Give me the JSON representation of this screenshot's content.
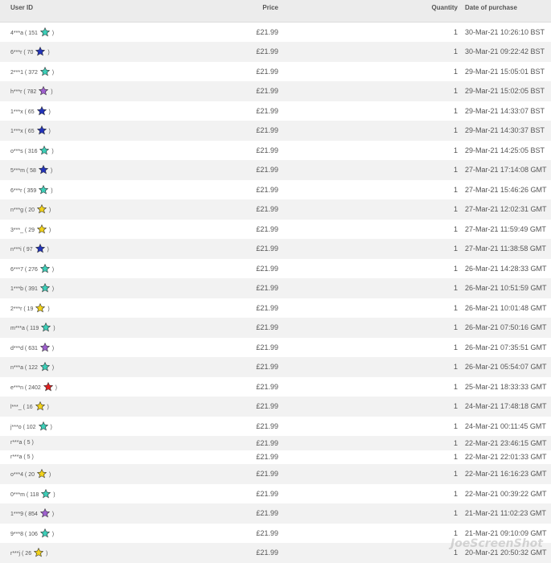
{
  "columns": {
    "user": "User ID",
    "price": "Price",
    "quantity": "Quantity",
    "date": "Date of purchase"
  },
  "star_colors": {
    "teal": "#3ccfb8",
    "blue": "#2233bb",
    "purple": "#a060d0",
    "yellow": "#f2d21a",
    "red": "#e02020"
  },
  "rows": [
    {
      "user": "4***a",
      "rating": "151",
      "star": "teal",
      "price": "£21.99",
      "qty": "1",
      "date": "30-Mar-21 10:26:10 BST"
    },
    {
      "user": "6***r",
      "rating": "70",
      "star": "blue",
      "price": "£21.99",
      "qty": "1",
      "date": "30-Mar-21 09:22:42 BST"
    },
    {
      "user": "2***1",
      "rating": "372",
      "star": "teal",
      "price": "£21.99",
      "qty": "1",
      "date": "29-Mar-21 15:05:01 BST"
    },
    {
      "user": "h***r",
      "rating": "782",
      "star": "purple",
      "price": "£21.99",
      "qty": "1",
      "date": "29-Mar-21 15:02:05 BST"
    },
    {
      "user": "1***x",
      "rating": "65",
      "star": "blue",
      "price": "£21.99",
      "qty": "1",
      "date": "29-Mar-21 14:33:07 BST"
    },
    {
      "user": "1***x",
      "rating": "65",
      "star": "blue",
      "price": "£21.99",
      "qty": "1",
      "date": "29-Mar-21 14:30:37 BST"
    },
    {
      "user": "o***s",
      "rating": "316",
      "star": "teal",
      "price": "£21.99",
      "qty": "1",
      "date": "29-Mar-21 14:25:05 BST"
    },
    {
      "user": "5***m",
      "rating": "58",
      "star": "blue",
      "price": "£21.99",
      "qty": "1",
      "date": "27-Mar-21 17:14:08 GMT"
    },
    {
      "user": "6***r",
      "rating": "359",
      "star": "teal",
      "price": "£21.99",
      "qty": "1",
      "date": "27-Mar-21 15:46:26 GMT"
    },
    {
      "user": "n***g",
      "rating": "20",
      "star": "yellow",
      "price": "£21.99",
      "qty": "1",
      "date": "27-Mar-21 12:02:31 GMT"
    },
    {
      "user": "3***_",
      "rating": "29",
      "star": "yellow",
      "price": "£21.99",
      "qty": "1",
      "date": "27-Mar-21 11:59:49 GMT"
    },
    {
      "user": "n***i",
      "rating": "97",
      "star": "blue",
      "price": "£21.99",
      "qty": "1",
      "date": "27-Mar-21 11:38:58 GMT"
    },
    {
      "user": "6***7",
      "rating": "276",
      "star": "teal",
      "price": "£21.99",
      "qty": "1",
      "date": "26-Mar-21 14:28:33 GMT"
    },
    {
      "user": "1***b",
      "rating": "391",
      "star": "teal",
      "price": "£21.99",
      "qty": "1",
      "date": "26-Mar-21 10:51:59 GMT"
    },
    {
      "user": "2***r",
      "rating": "19",
      "star": "yellow",
      "price": "£21.99",
      "qty": "1",
      "date": "26-Mar-21 10:01:48 GMT"
    },
    {
      "user": "m***a",
      "rating": "119",
      "star": "teal",
      "price": "£21.99",
      "qty": "1",
      "date": "26-Mar-21 07:50:16 GMT"
    },
    {
      "user": "d***d",
      "rating": "631",
      "star": "purple",
      "price": "£21.99",
      "qty": "1",
      "date": "26-Mar-21 07:35:51 GMT"
    },
    {
      "user": "n***a",
      "rating": "122",
      "star": "teal",
      "price": "£21.99",
      "qty": "1",
      "date": "26-Mar-21 05:54:07 GMT"
    },
    {
      "user": "e***n",
      "rating": "2402",
      "star": "red",
      "price": "£21.99",
      "qty": "1",
      "date": "25-Mar-21 18:33:33 GMT"
    },
    {
      "user": "l***_",
      "rating": "16",
      "star": "yellow",
      "price": "£21.99",
      "qty": "1",
      "date": "24-Mar-21 17:48:18 GMT"
    },
    {
      "user": "j***o",
      "rating": "102",
      "star": "teal",
      "price": "£21.99",
      "qty": "1",
      "date": "24-Mar-21 00:11:45 GMT"
    },
    {
      "user": "r***a",
      "rating": "5",
      "star": "",
      "price": "£21.99",
      "qty": "1",
      "date": "22-Mar-21 23:46:15 GMT",
      "short": true
    },
    {
      "user": "r***a",
      "rating": "5",
      "star": "",
      "price": "£21.99",
      "qty": "1",
      "date": "22-Mar-21 22:01:33 GMT",
      "short": true
    },
    {
      "user": "o***4",
      "rating": "20",
      "star": "yellow",
      "price": "£21.99",
      "qty": "1",
      "date": "22-Mar-21 16:16:23 GMT"
    },
    {
      "user": "0***m",
      "rating": "118",
      "star": "teal",
      "price": "£21.99",
      "qty": "1",
      "date": "22-Mar-21 00:39:22 GMT"
    },
    {
      "user": "1***9",
      "rating": "854",
      "star": "purple",
      "price": "£21.99",
      "qty": "1",
      "date": "21-Mar-21 11:02:23 GMT"
    },
    {
      "user": "9***8",
      "rating": "106",
      "star": "teal",
      "price": "£21.99",
      "qty": "1",
      "date": "21-Mar-21 09:10:09 GMT"
    },
    {
      "user": "r***j",
      "rating": "26",
      "star": "yellow",
      "price": "£21.99",
      "qty": "1",
      "date": "20-Mar-21 20:50:32 GMT"
    }
  ],
  "watermark": "JoeScreenShot"
}
